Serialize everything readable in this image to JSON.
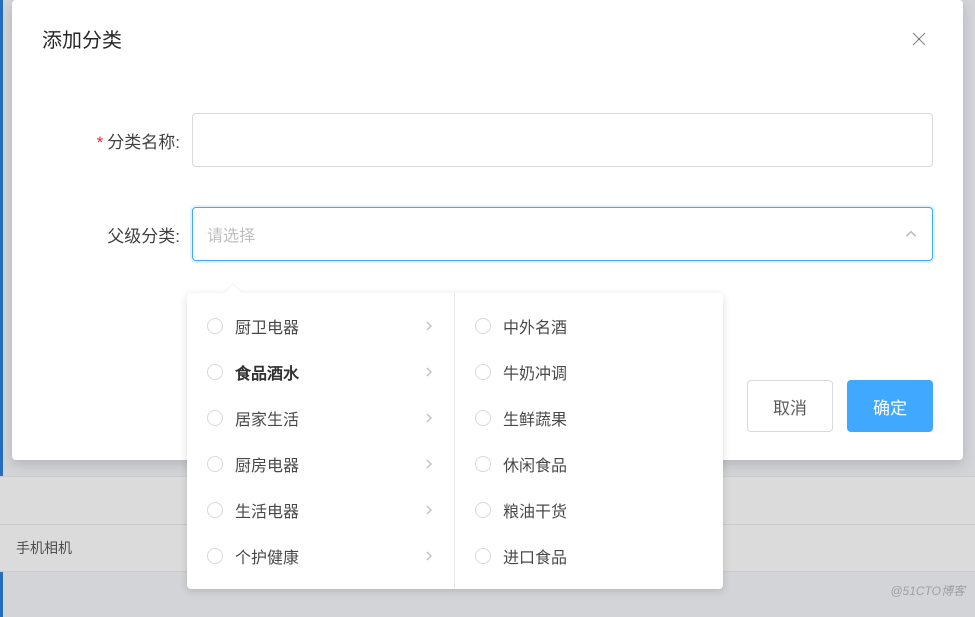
{
  "modal": {
    "title": "添加分类",
    "close_aria": "关闭"
  },
  "form": {
    "name_label": "分类名称:",
    "name_value": "",
    "parent_label": "父级分类:",
    "parent_placeholder": "请选择"
  },
  "cascader": {
    "panel1": [
      {
        "label": "厨卫电器",
        "has_children": true,
        "active": false
      },
      {
        "label": "食品酒水",
        "has_children": true,
        "active": true
      },
      {
        "label": "居家生活",
        "has_children": true,
        "active": false
      },
      {
        "label": "厨房电器",
        "has_children": true,
        "active": false
      },
      {
        "label": "生活电器",
        "has_children": true,
        "active": false
      },
      {
        "label": "个护健康",
        "has_children": true,
        "active": false
      }
    ],
    "panel2": [
      {
        "label": "中外名酒"
      },
      {
        "label": "牛奶冲调"
      },
      {
        "label": "生鲜蔬果"
      },
      {
        "label": "休闲食品"
      },
      {
        "label": "粮油干货"
      },
      {
        "label": "进口食品"
      }
    ]
  },
  "footer": {
    "cancel": "取消",
    "confirm": "确定"
  },
  "background": {
    "row2": "手机相机"
  },
  "watermark": "@51CTO博客"
}
